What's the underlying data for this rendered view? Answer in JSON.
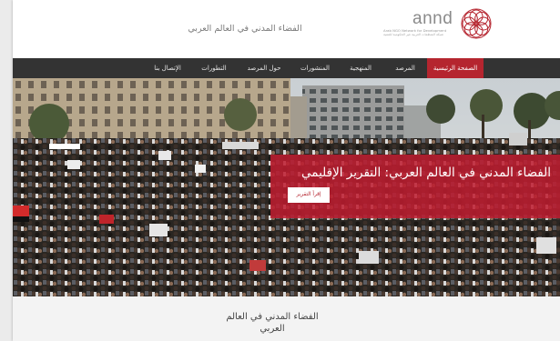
{
  "header": {
    "site_title": "الفضاء المدني في العالم العربي",
    "logo": {
      "wordmark": "annd",
      "tagline_en": "Arab NGO Network for Development",
      "tagline_ar": "شبكة المنظمات العربية غير الحكومية للتنمية"
    }
  },
  "nav": {
    "items": [
      {
        "label": "الصفحة الرئيسية",
        "active": true
      },
      {
        "label": "المرصد",
        "active": false
      },
      {
        "label": "المنهجية",
        "active": false
      },
      {
        "label": "المنشورات",
        "active": false
      },
      {
        "label": "حول المرصد",
        "active": false
      },
      {
        "label": "التطورات",
        "active": false
      },
      {
        "label": "الإتصال بنا",
        "active": false
      }
    ]
  },
  "hero": {
    "heading": "الفضاء المدني في العالم العربي: التقرير الإقليمي",
    "button_label": "إقرأ التقرير"
  },
  "intro": {
    "title": "الفضاء المدني في العالم العربي"
  },
  "colors": {
    "accent": "#b5252f",
    "nav_bg": "#333333",
    "overlay": "#be1c30"
  }
}
